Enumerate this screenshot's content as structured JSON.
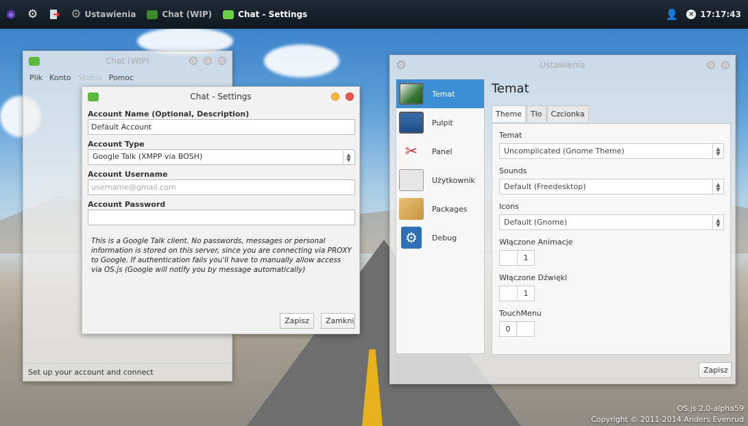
{
  "panel": {
    "items": [
      {
        "label": "Ustawienia"
      },
      {
        "label": "Chat (WIP)"
      },
      {
        "label": "Chat - Settings"
      }
    ],
    "clock": "17:17:43"
  },
  "chat_main": {
    "title": "Chat (WIP)",
    "menu": [
      "Plik",
      "Konto",
      "Status",
      "Pomoc"
    ],
    "status": "Set up your account and connect"
  },
  "chat_settings": {
    "title": "Chat - Settings",
    "account_name_label": "Account Name (Optional, Description)",
    "account_name_value": "Default Account",
    "account_type_label": "Account Type",
    "account_type_value": "Google Talk (XMPP via BOSH)",
    "username_label": "Account Username",
    "username_placeholder": "username@gmail.com",
    "password_label": "Account Password",
    "info": "This is a Google Talk client. No passwords, messages or personal information is stored on this server, since you are connecting via PROXY to Google. If authentication fails you'll have to manually allow access via OS.js (Google will notify you by message automatically)",
    "save": "Zapisz",
    "close": "Zamknij"
  },
  "settings": {
    "title": "Ustawienia",
    "sidebar": [
      {
        "label": "Temat",
        "icon": "theme-icon"
      },
      {
        "label": "Pulpit",
        "icon": "desktop-icon"
      },
      {
        "label": "Panel",
        "icon": "panel-icon"
      },
      {
        "label": "Użytkownik",
        "icon": "user-icon"
      },
      {
        "label": "Packages",
        "icon": "packages-icon"
      },
      {
        "label": "Debug",
        "icon": "debug-icon"
      }
    ],
    "heading": "Temat",
    "tabs": [
      "Theme",
      "Tło",
      "Czcionka"
    ],
    "fields": {
      "theme_label": "Temat",
      "theme_value": "Uncomplicated (Gnome Theme)",
      "sounds_label": "Sounds",
      "sounds_value": "Default (Freedesktop)",
      "icons_label": "Icons",
      "icons_value": "Default (Gnome)",
      "animations_label": "Włączone Animacje",
      "animations_value": "1",
      "sounds_enabled_label": "Włączone Dźwięki",
      "sounds_enabled_value": "1",
      "touchmenu_label": "TouchMenu",
      "touchmenu_value": "0"
    },
    "save": "Zapisz"
  },
  "footer": {
    "version": "OS.js 2.0-alpha59",
    "copyright": "Copyright © 2011-2014 Anders Evenrud"
  },
  "colors": {
    "accent": "#3d8fd5",
    "panel_bg": "#141e28",
    "chat_green": "#5db93d"
  }
}
